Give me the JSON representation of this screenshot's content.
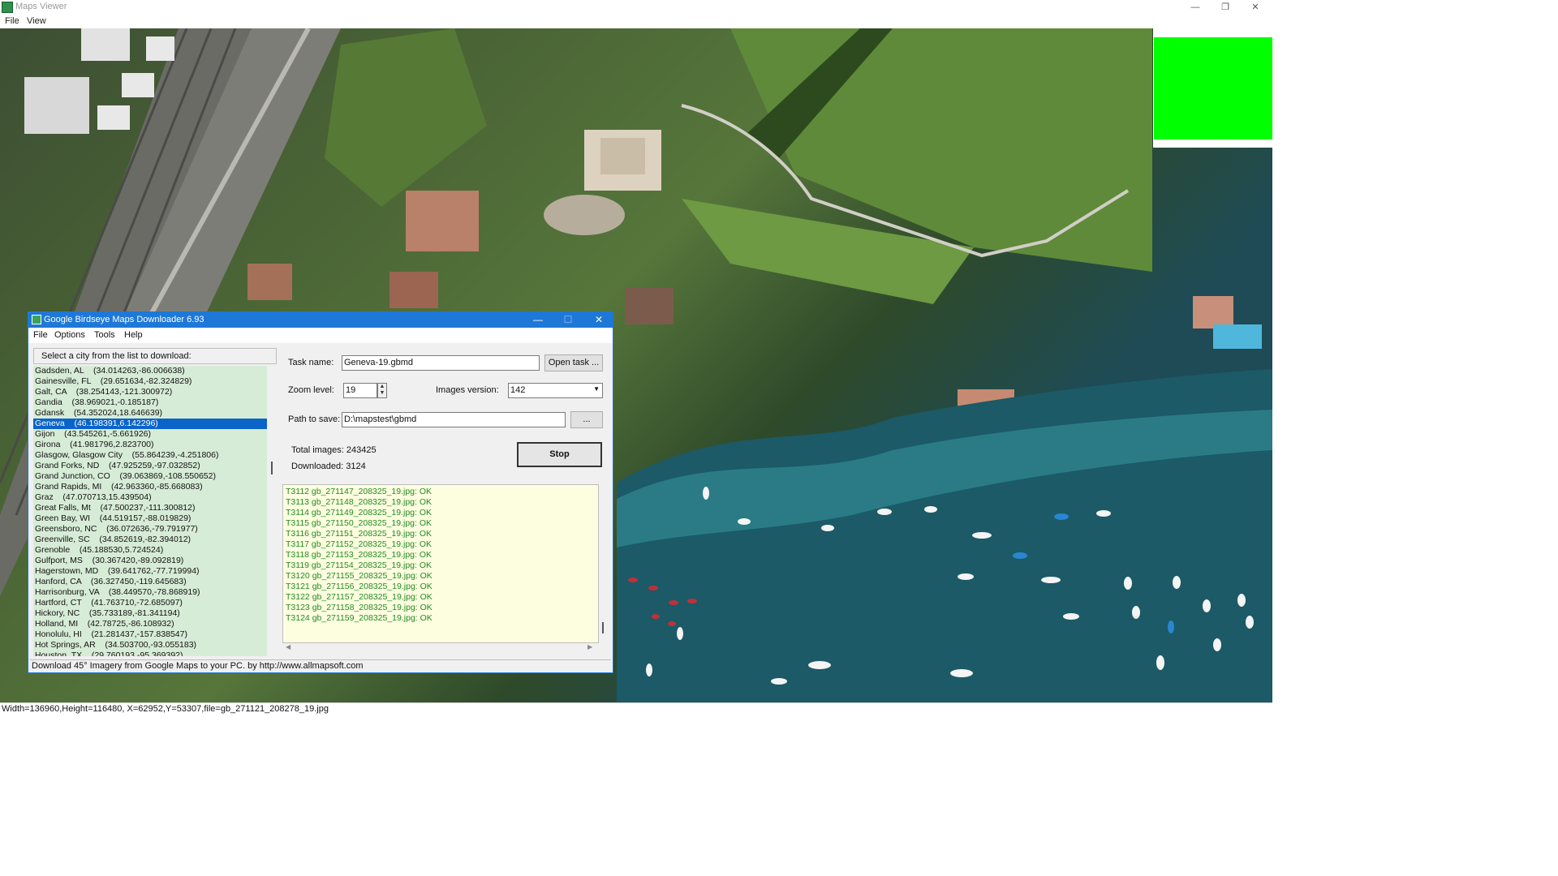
{
  "app": {
    "title": "Maps Viewer",
    "menu": [
      "File",
      "View"
    ],
    "window_controls": {
      "minimize": "—",
      "restore": "❐",
      "close": "✕"
    }
  },
  "map": {
    "overlay_color": "#00ff00"
  },
  "status_bar": {
    "text": "Width=136960,Height=116480, X=62952,Y=53307,file=gb_271121_208278_19.jpg"
  },
  "dialog": {
    "title": "Google Birdseye Maps Downloader 6.93",
    "window_controls": {
      "minimize": "—",
      "maximize": "☐",
      "close": "✕"
    },
    "menu": [
      "File",
      "Options",
      "Tools",
      "Help"
    ],
    "city_header": "Select a city from the list to download:",
    "cities": [
      "Gadsden, AL    (34.014263,-86.006638)",
      "Gainesville, FL    (29.651634,-82.324829)",
      "Galt, CA    (38.254143,-121.300972)",
      "Gandia    (38.969021,-0.185187)",
      "Gdansk    (54.352024,18.646639)",
      "Geneva    (46.198391,6.142296)",
      "Gijon    (43.545261,-5.661926)",
      "Girona    (41.981796,2.823700)",
      "Glasgow, Glasgow City    (55.864239,-4.251806)",
      "Grand Forks, ND    (47.925259,-97.032852)",
      "Grand Junction, CO    (39.063869,-108.550652)",
      "Grand Rapids, MI    (42.963360,-85.668083)",
      "Graz    (47.070713,15.439504)",
      "Great Falls, Mt    (47.500237,-111.300812)",
      "Green Bay, WI    (44.519157,-88.019829)",
      "Greensboro, NC    (36.072636,-79.791977)",
      "Greenville, SC    (34.852619,-82.394012)",
      "Grenoble    (45.188530,5.724524)",
      "Gulfport, MS    (30.367420,-89.092819)",
      "Hagerstown, MD    (39.641762,-77.719994)",
      "Hanford, CA    (36.327450,-119.645683)",
      "Harrisonburg, VA    (38.449570,-78.868919)",
      "Hartford, CT    (41.763710,-72.685097)",
      "Hickory, NC    (35.733189,-81.341194)",
      "Holland, MI    (42.78725,-86.108932)",
      "Honolulu, HI    (21.281437,-157.838547)",
      "Hot Springs, AR    (34.503700,-93.055183)",
      "Houston, TX    (29.760193,-95.369392)"
    ],
    "selected_city_index": 5,
    "task_name_label": "Task name:",
    "task_name_value": "Geneva-19.gbmd",
    "open_task_button": "Open task ...",
    "zoom_label": "Zoom level:",
    "zoom_value": "19",
    "images_version_label": "Images version:",
    "images_version_value": "142",
    "path_label": "Path to save:",
    "path_value": "D:\\mapstest\\gbmd",
    "browse_button": "...",
    "total_images": "Total images: 243425",
    "downloaded": "Downloaded: 3124",
    "stop_button": "Stop",
    "log": [
      "T3112 gb_271147_208325_19.jpg: OK",
      "T3113 gb_271148_208325_19.jpg: OK",
      "T3114 gb_271149_208325_19.jpg: OK",
      "T3115 gb_271150_208325_19.jpg: OK",
      "T3116 gb_271151_208325_19.jpg: OK",
      "T3117 gb_271152_208325_19.jpg: OK",
      "T3118 gb_271153_208325_19.jpg: OK",
      "T3119 gb_271154_208325_19.jpg: OK",
      "T3120 gb_271155_208325_19.jpg: OK",
      "T3121 gb_271156_208325_19.jpg: OK",
      "T3122 gb_271157_208325_19.jpg: OK",
      "T3123 gb_271158_208325_19.jpg: OK",
      "T3124 gb_271159_208325_19.jpg: OK"
    ],
    "status": "Download 45° Imagery from Google Maps to your PC.  by http://www.allmapsoft.com"
  }
}
